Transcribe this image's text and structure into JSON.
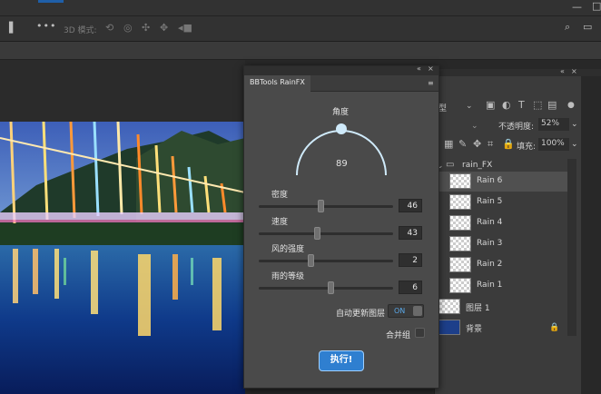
{
  "options_bar": {
    "mode_3d_label": "3D 模式:"
  },
  "rainfx": {
    "panel_title": "BBTools RainFX",
    "angle": {
      "label": "角度",
      "value": "89"
    },
    "sliders": [
      {
        "label": "密度",
        "value": "46",
        "fraction": 0.46
      },
      {
        "label": "速度",
        "value": "43",
        "fraction": 0.43
      },
      {
        "label": "风的强度",
        "value": "2",
        "fraction": 0.38
      },
      {
        "label": "雨的等级",
        "value": "6",
        "fraction": 0.54
      }
    ],
    "auto_update": {
      "label": "自动更新图层",
      "state": "ON"
    },
    "merge": {
      "label": "合并组"
    },
    "run_button": "执行!"
  },
  "layers_panel": {
    "kind_filter": "型",
    "opacity_label": "不透明度:",
    "opacity_value": "52%",
    "fill_label": "填充:",
    "fill_value": "100%",
    "group_name": "rain_FX",
    "layers": [
      "Rain 6",
      "Rain 5",
      "Rain 4",
      "Rain 3",
      "Rain 2",
      "Rain 1"
    ],
    "layer_1": "图层 1",
    "background": "背景"
  },
  "colors": {
    "accent": "#2f7fd0",
    "arc": "#cfeafa"
  }
}
